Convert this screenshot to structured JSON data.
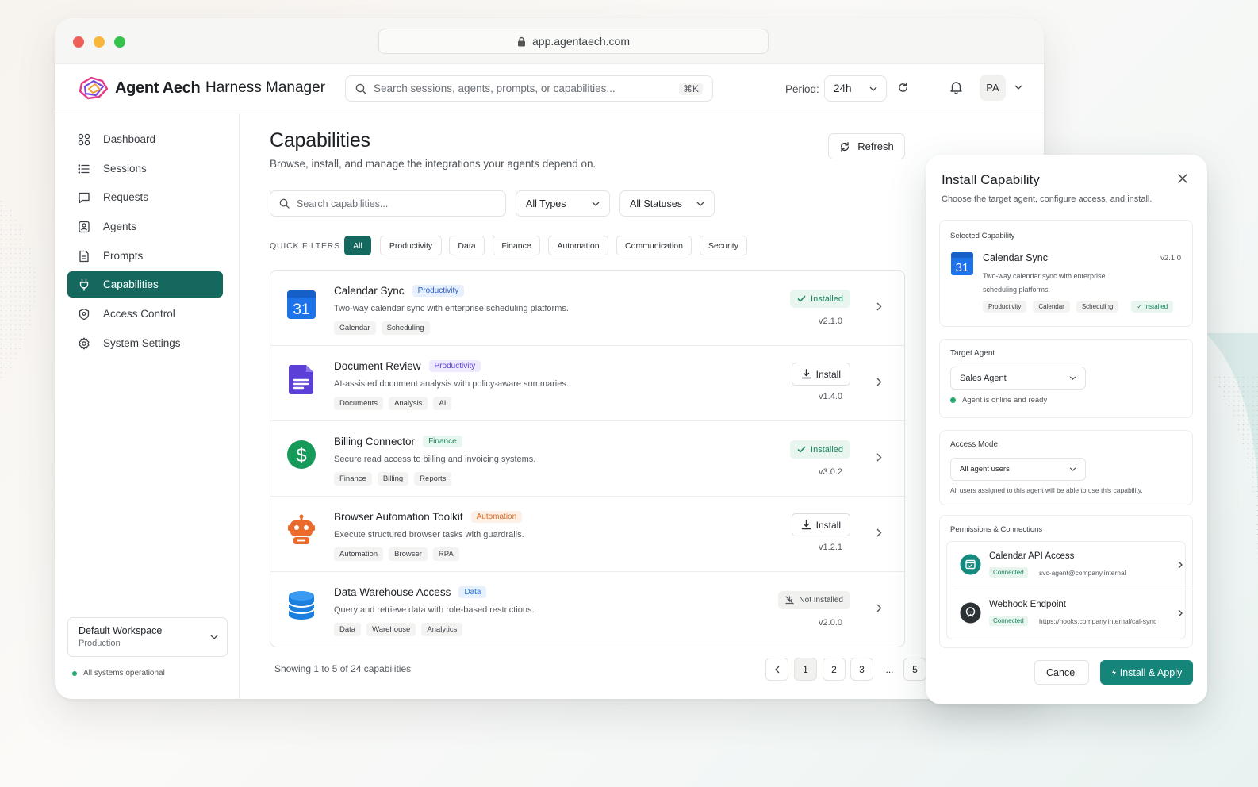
{
  "browser": {
    "url": "app.agentaech.com"
  },
  "header": {
    "brand": "Agent Aech",
    "product": "Harness Manager",
    "search_placeholder": "Search sessions, agents, prompts, or capabilities...",
    "search_shortcut": "⌘K",
    "period_label": "Period:",
    "period_value": "24h",
    "avatar_initials": "PA"
  },
  "sidebar": {
    "items": [
      {
        "label": "Dashboard",
        "icon": "dashboard-icon"
      },
      {
        "label": "Sessions",
        "icon": "list-icon"
      },
      {
        "label": "Requests",
        "icon": "chat-icon"
      },
      {
        "label": "Agents",
        "icon": "agent-icon"
      },
      {
        "label": "Prompts",
        "icon": "document-icon"
      },
      {
        "label": "Capabilities",
        "icon": "plug-icon",
        "active": true
      },
      {
        "label": "Access Control",
        "icon": "shield-icon"
      },
      {
        "label": "System Settings",
        "icon": "gear-icon"
      }
    ],
    "workspace": {
      "name": "Default Workspace",
      "env": "Production"
    },
    "status": "All systems operational"
  },
  "page": {
    "title": "Capabilities",
    "subtitle": "Browse, install, and manage the integrations your agents depend on.",
    "refresh_label": "Refresh",
    "search_placeholder": "Search capabilities...",
    "type_filter": "All Types",
    "status_filter": "All Statuses",
    "quick_filters_label": "QUICK FILTERS",
    "quick_filters": [
      "All",
      "Productivity",
      "Data",
      "Finance",
      "Automation",
      "Communication",
      "Security"
    ]
  },
  "capabilities": [
    {
      "name": "Calendar Sync",
      "category": "Productivity",
      "description": "Two-way calendar sync with enterprise scheduling platforms.",
      "tags": [
        "Calendar",
        "Scheduling"
      ],
      "status": "Installed",
      "version": "v2.1.0",
      "icon": "calendar-icon"
    },
    {
      "name": "Document Review",
      "category": "Productivity",
      "description": "AI-assisted document analysis with policy-aware summaries.",
      "tags": [
        "Documents",
        "Analysis",
        "AI"
      ],
      "status": "Install",
      "version": "v1.4.0",
      "icon": "document-icon"
    },
    {
      "name": "Billing Connector",
      "category": "Finance",
      "description": "Secure read access to billing and invoicing systems.",
      "tags": [
        "Finance",
        "Billing",
        "Reports"
      ],
      "status": "Installed",
      "version": "v3.0.2",
      "icon": "dollar-icon"
    },
    {
      "name": "Browser Automation Toolkit",
      "category": "Automation",
      "description": "Execute structured browser tasks with guardrails.",
      "tags": [
        "Automation",
        "Browser",
        "RPA"
      ],
      "status": "Install",
      "version": "v1.2.1",
      "icon": "robot-icon"
    },
    {
      "name": "Data Warehouse Access",
      "category": "Data",
      "description": "Query and retrieve data with role-based restrictions.",
      "tags": [
        "Data",
        "Warehouse",
        "Analytics"
      ],
      "status": "Not Installed",
      "version": "v2.0.0",
      "icon": "database-icon"
    }
  ],
  "pagination": {
    "showing": "Showing 1 to 5 of 24 capabilities",
    "pages": [
      "1",
      "2",
      "3",
      "...",
      "5"
    ],
    "current": "1"
  },
  "install_panel": {
    "title": "Install Capability",
    "subtitle": "Choose the target agent, configure access, and install.",
    "selected_label": "Selected Capability",
    "selected": {
      "name": "Calendar Sync",
      "version": "v2.1.0",
      "description_line1": "Two-way calendar sync with enterprise",
      "description_line2": "scheduling platforms.",
      "tags": [
        "Productivity",
        "Calendar",
        "Scheduling"
      ],
      "status": "Installed",
      "icon_text": "31"
    },
    "target_label": "Target Agent",
    "target_value": "Sales Agent",
    "target_status": "Agent is online and ready",
    "access_label": "Access Mode",
    "access_value": "All agent users",
    "access_note": "All users assigned to this agent will be able to use this capability.",
    "permissions_label": "Permissions & Connections",
    "connections": [
      {
        "name": "Calendar API Access",
        "status": "Connected",
        "detail": "svc-agent@company.internal",
        "icon": "calendar-api-icon"
      },
      {
        "name": "Webhook Endpoint",
        "status": "Connected",
        "detail": "https://hooks.company.internal/cal-sync",
        "icon": "webhook-icon"
      }
    ],
    "cancel_label": "Cancel",
    "apply_label": "Install & Apply"
  },
  "colors": {
    "accent": "#15685e",
    "apply": "#15857a",
    "installed": "#17865a"
  }
}
